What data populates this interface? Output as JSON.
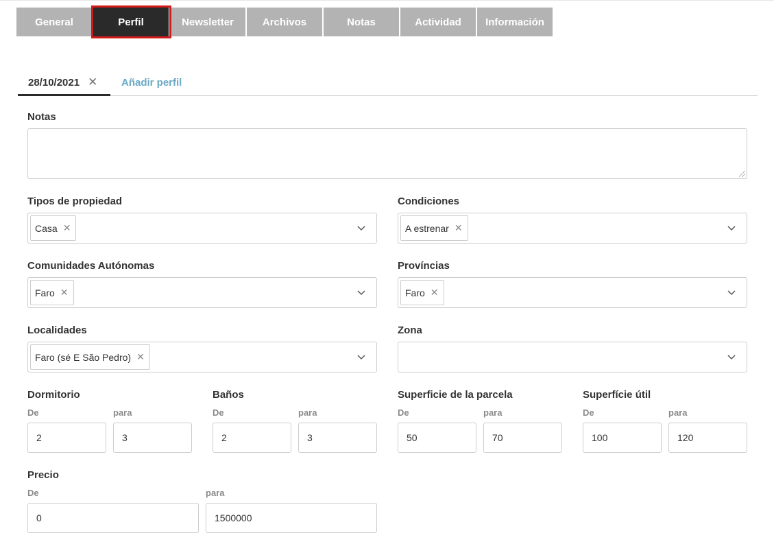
{
  "tabs": [
    {
      "label": "General"
    },
    {
      "label": "Perfil"
    },
    {
      "label": "Newsletter"
    },
    {
      "label": "Archivos"
    },
    {
      "label": "Notas"
    },
    {
      "label": "Actividad"
    },
    {
      "label": "Información"
    }
  ],
  "active_tab": "Perfil",
  "profile_tabs": {
    "active_label": "28/10/2021",
    "close_glyph": "✕",
    "add_label": "Añadir perfil"
  },
  "form": {
    "notes": {
      "label": "Notas",
      "value": ""
    },
    "property_types": {
      "label": "Tipos de propiedad",
      "chips": [
        "Casa"
      ]
    },
    "conditions": {
      "label": "Condiciones",
      "chips": [
        "A estrenar"
      ]
    },
    "communities": {
      "label": "Comunidades Autónomas",
      "chips": [
        "Faro"
      ]
    },
    "provinces": {
      "label": "Províncias",
      "chips": [
        "Faro"
      ]
    },
    "localities": {
      "label": "Localidades",
      "chips": [
        "Faro (sé E São Pedro)"
      ]
    },
    "zone": {
      "label": "Zona",
      "chips": []
    },
    "chip_remove_glyph": "✕",
    "from_label": "De",
    "to_label": "para",
    "bedrooms": {
      "label": "Dormitorio",
      "from": "2",
      "to": "3"
    },
    "bathrooms": {
      "label": "Baños",
      "from": "2",
      "to": "3"
    },
    "plot_area": {
      "label": "Superficie de la parcela",
      "from": "50",
      "to": "70"
    },
    "usable_area": {
      "label": "Superfície útil",
      "from": "100",
      "to": "120"
    },
    "price": {
      "label": "Precio",
      "from": "0",
      "to": "1500000"
    }
  },
  "colors": {
    "tab_inactive": "#b3b3b3",
    "tab_active": "#2a2a2a",
    "highlight": "#d11a1a",
    "link": "#6aa9c4"
  }
}
